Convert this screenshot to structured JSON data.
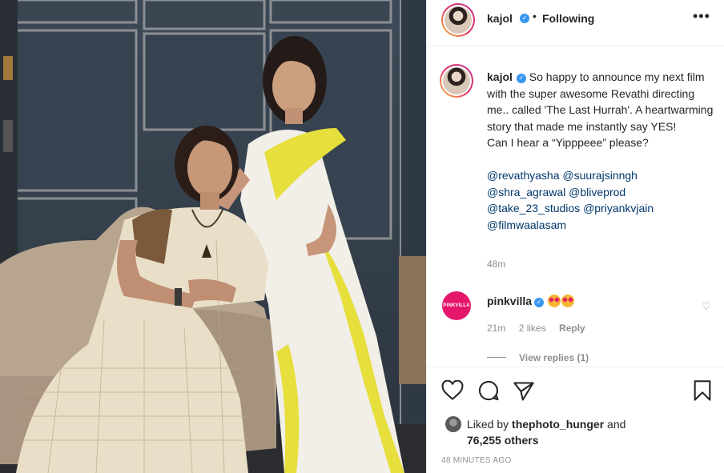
{
  "post": {
    "username": "kajol",
    "follow_state": "Following",
    "more_label": "•••",
    "dot": "•"
  },
  "caption": {
    "username": "kajol",
    "lines": [
      "So happy to announce my next film with the super awesome Revathi directing me.. called 'The Last Hurrah'. A heartwarming story that made me instantly say YES!",
      "Can I hear a “Yipppeee” please?"
    ],
    "mentions_lines": [
      "@revathyasha @suurajsinngh",
      "@shra_agrawal @bliveprod",
      "@take_23_studios @priyankvjain",
      "@filmwaalasam"
    ],
    "time": "48m"
  },
  "comment": {
    "username": "pinkvilla",
    "avatar_text": "PINKVILLA",
    "emoji": [
      "heart-eyes-emoji",
      "heart-eyes-emoji"
    ],
    "time": "21m",
    "likes": "2 likes",
    "reply": "Reply",
    "view_replies": "View replies (1)"
  },
  "likes": {
    "prefix": "Liked by ",
    "user": "thephoto_hunger",
    "and": " and",
    "count": "76,255 others"
  },
  "timestamp": "48 MINUTES AGO",
  "colors": {
    "verified": "#3897f0",
    "mention": "#00376b",
    "pinkvilla": "#e5176d",
    "muted": "#8e8e8e"
  }
}
